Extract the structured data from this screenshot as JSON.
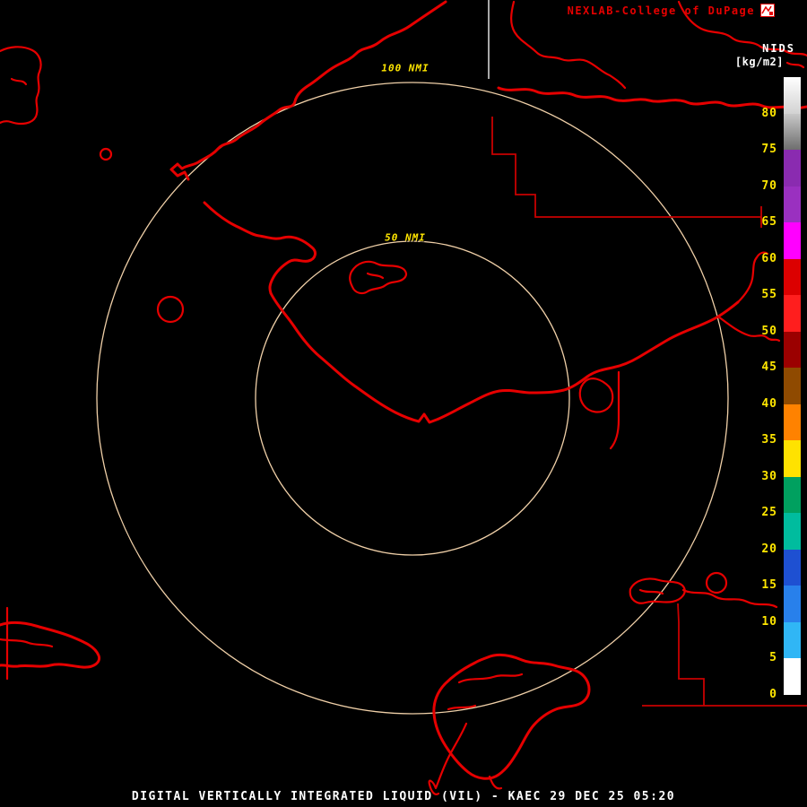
{
  "colors": {
    "bg": "#000000",
    "map-red": "#E60000",
    "boundary-red": "#C80000",
    "ring": "#F0D0A8",
    "label-yellow": "#FFE600",
    "text-white": "#FFFFFF",
    "brand-red": "#E60000",
    "sector-line": "#E0E0E0"
  },
  "header": {
    "brand": "NEXLAB-College of DuPage",
    "scale_title": "NIDS",
    "scale_units": "[kg/m2]"
  },
  "map": {
    "ring_labels": [
      "100 NMI",
      "50 NMI"
    ]
  },
  "colorbar": {
    "ticks": [
      "80",
      "75",
      "70",
      "65",
      "60",
      "55",
      "50",
      "45",
      "40",
      "35",
      "30",
      "25",
      "20",
      "15",
      "10",
      "5",
      "0"
    ],
    "segments": [
      {
        "range": "80+",
        "color": "#FFFFFF",
        "color2": "#D2D2D2"
      },
      {
        "range": "75-80",
        "color": "#C8C8C8",
        "color2": "#6E6E6E"
      },
      {
        "range": "70-75",
        "color": "#8A2BB0"
      },
      {
        "range": "65-70",
        "color": "#9A30C0"
      },
      {
        "range": "60-65",
        "color": "#FF00FF"
      },
      {
        "range": "55-60",
        "color": "#DC0000"
      },
      {
        "range": "50-55",
        "color": "#FF1E1E"
      },
      {
        "range": "45-50",
        "color": "#9B0000"
      },
      {
        "range": "40-45",
        "color": "#8F4A00"
      },
      {
        "range": "35-40",
        "color": "#FF8200"
      },
      {
        "range": "30-35",
        "color": "#FFE200"
      },
      {
        "range": "25-30",
        "color": "#00A05F"
      },
      {
        "range": "20-25",
        "color": "#00BC9E"
      },
      {
        "range": "15-20",
        "color": "#1E50D2"
      },
      {
        "range": "10-15",
        "color": "#2880EB"
      },
      {
        "range": "5-10",
        "color": "#30B6F5"
      },
      {
        "range": "0-5",
        "color": "#FFFFFF"
      }
    ]
  },
  "footer": {
    "title": "DIGITAL VERTICALLY INTEGRATED LIQUID (VIL) - KAEC 29 DEC 25 05:20"
  }
}
